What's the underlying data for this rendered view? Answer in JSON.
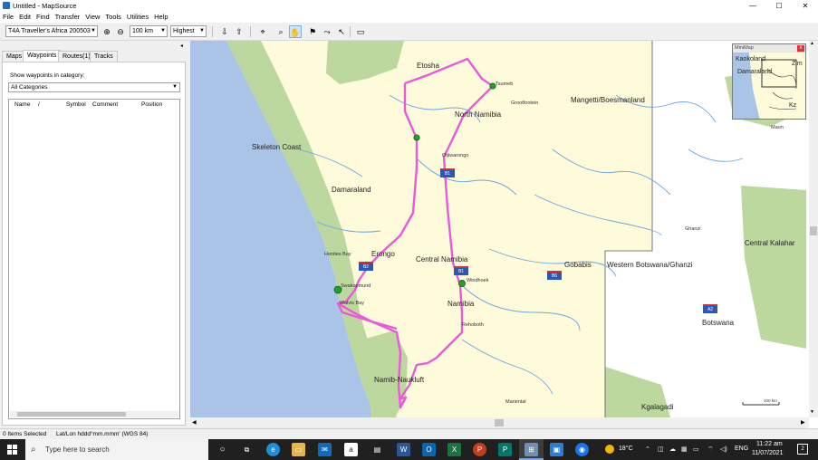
{
  "window": {
    "title": "Untitled - MapSource",
    "min": "—",
    "max": "☐",
    "close": "✕"
  },
  "menu": [
    "File",
    "Edit",
    "Find",
    "Transfer",
    "View",
    "Tools",
    "Utilities",
    "Help"
  ],
  "toolbar": {
    "map_product": "T4A Traveller's Africa 200503",
    "zoom": "100 km",
    "detail": "Highest"
  },
  "left_panel": {
    "tabs": [
      "Maps",
      "Waypoints",
      "Routes(1)",
      "Tracks"
    ],
    "active_tab": "Waypoints",
    "show_label": "Show waypoints in category:",
    "category": "All Categories",
    "columns": [
      "Name",
      "/",
      "Symbol",
      "Comment",
      "Position"
    ]
  },
  "map": {
    "regions": {
      "etosha": "Etosha",
      "north_namibia": "North Namibia",
      "skeleton_coast": "Skeleton Coast",
      "damaraland": "Damaraland",
      "erongo": "Erongo",
      "central_namibia": "Central Namibia",
      "namibia": "Namibia",
      "namib_naukluft": "Namib-Naukluft",
      "mangetti": "Mangetti/Boesmanland",
      "gobabis": "Gobabis",
      "west_botswana": "Western Botswana/Ghanzi",
      "central_kalahari": "Central Kalahar",
      "botswana": "Botswana",
      "kgalagadi": "Kgalagadi"
    },
    "towns": {
      "tsumeb": "Tsumeb",
      "grootfontein": "Grootfontein",
      "otjiwarongo": "Otjiwarongo",
      "henties_bay": "Henties Bay",
      "swakopmund": "Swakopmund",
      "walvis_bay": "Walvis Bay",
      "windhoek": "Windhoek",
      "rehoboth": "Rehoboth",
      "mariental": "Mariental",
      "ghanzi": "Ghanzi",
      "maun": "Maun"
    },
    "shields": {
      "b1_north": "B1",
      "b2": "B2",
      "b1_central": "B1",
      "b6": "B6",
      "a2": "A2"
    },
    "scale": "100 km",
    "minimap": {
      "title": "MiniMap",
      "close": "x",
      "labels": [
        "Kaokoland",
        "Damaraland",
        "Zim",
        "Ok",
        "Kz"
      ]
    }
  },
  "status": {
    "items": "0 Items Selected",
    "format": "Lat/Lon hddd°mm.mmm' (WGS 84)"
  },
  "taskbar": {
    "search_placeholder": "Type here to search",
    "temperature": "18°C",
    "language": "ENG",
    "time": "11:22 am",
    "date": "11/07/2021",
    "notifications": "2"
  },
  "colors": {
    "route": "#e85ad8",
    "ocean": "#a9c4e6",
    "land": "#fdfbd9",
    "park": "#bcd89f",
    "river": "#6aa4e6"
  }
}
